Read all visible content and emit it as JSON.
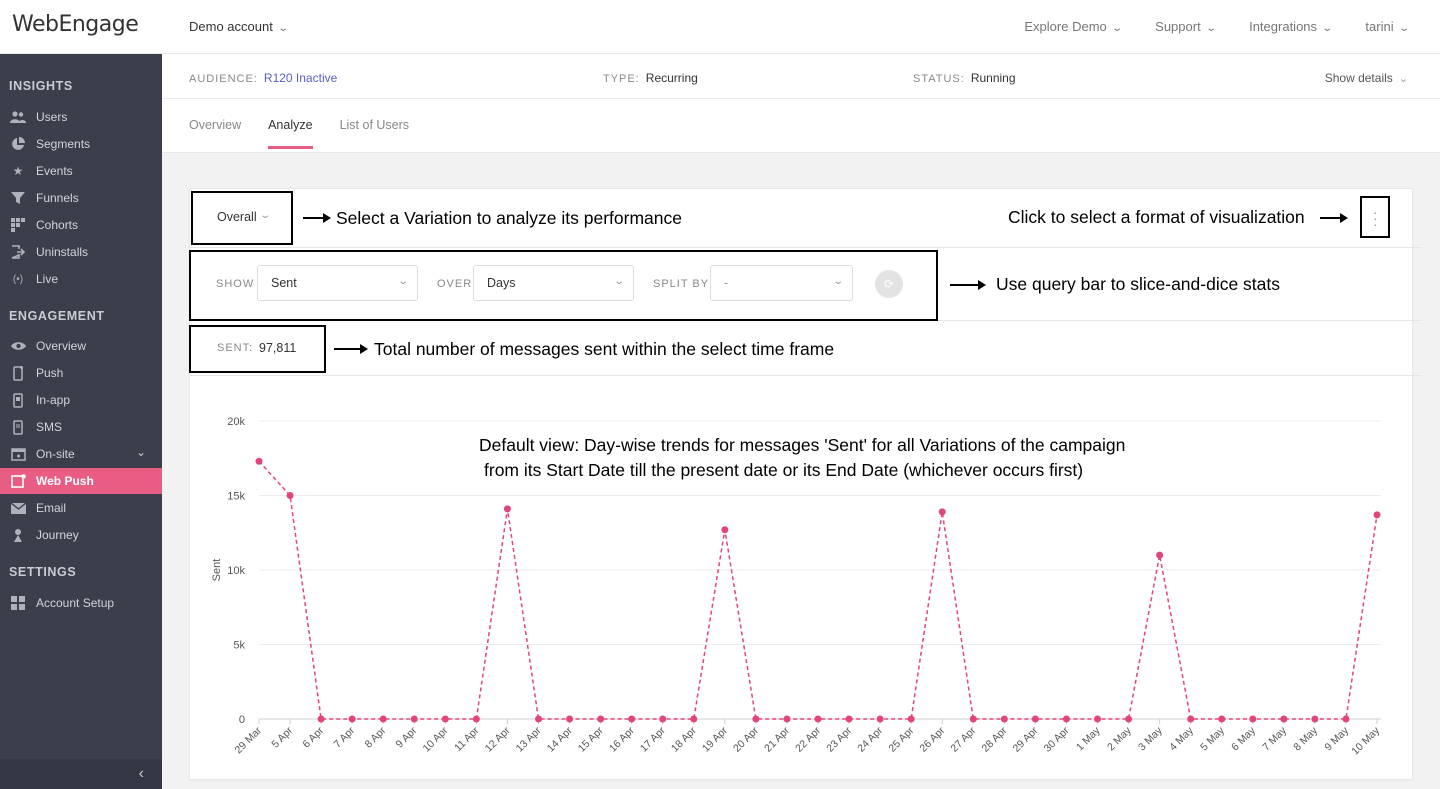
{
  "app": {
    "logo_text": "WebEngage",
    "account": "Demo account",
    "topnav": [
      "Explore Demo",
      "Support",
      "Integrations",
      "tarini"
    ]
  },
  "sidebar": {
    "sections": [
      {
        "title": "INSIGHTS",
        "items": [
          {
            "label": "Users",
            "icon": "users-icon"
          },
          {
            "label": "Segments",
            "icon": "pie-icon"
          },
          {
            "label": "Events",
            "icon": "star-icon"
          },
          {
            "label": "Funnels",
            "icon": "funnel-icon"
          },
          {
            "label": "Cohorts",
            "icon": "grid-icon"
          },
          {
            "label": "Uninstalls",
            "icon": "exit-icon"
          },
          {
            "label": "Live",
            "icon": "broadcast-icon"
          }
        ]
      },
      {
        "title": "ENGAGEMENT",
        "items": [
          {
            "label": "Overview",
            "icon": "eye-icon"
          },
          {
            "label": "Push",
            "icon": "mobile-icon"
          },
          {
            "label": "In-app",
            "icon": "tablet-icon"
          },
          {
            "label": "SMS",
            "icon": "sms-icon"
          },
          {
            "label": "On-site",
            "icon": "window-icon"
          },
          {
            "label": "Web Push",
            "icon": "browser-icon",
            "active": true
          },
          {
            "label": "Email",
            "icon": "mail-icon"
          },
          {
            "label": "Journey",
            "icon": "journey-icon"
          }
        ]
      },
      {
        "title": "SETTINGS",
        "items": [
          {
            "label": "Account Setup",
            "icon": "setup-icon"
          }
        ]
      }
    ]
  },
  "campaign": {
    "audience_label": "AUDIENCE:",
    "audience_value": "R120 Inactive",
    "type_label": "TYPE:",
    "type_value": "Recurring",
    "status_label": "STATUS:",
    "status_value": "Running",
    "show_details": "Show details",
    "tabs": [
      "Overview",
      "Analyze",
      "List of Users"
    ],
    "active_tab": "Analyze"
  },
  "analyze": {
    "variation_select": "Overall",
    "query": {
      "show_label": "SHOW",
      "show_value": "Sent",
      "over_label": "OVER",
      "over_value": "Days",
      "split_label": "SPLIT BY",
      "split_value": "-"
    },
    "sent_label": "SENT:",
    "sent_value": "97,811"
  },
  "annotations": {
    "variation": "Select a Variation to analyze its performance",
    "visualization": "Click to select a format of visualization",
    "query_bar": "Use query bar to slice-and-dice stats",
    "total": "Total number of messages sent within the select time frame",
    "default_view_1": "Default view: Day-wise trends for messages 'Sent' for all Variations of the campaign",
    "default_view_2": "from its Start Date till the present date or its End Date (whichever occurs first)"
  },
  "chart_data": {
    "type": "line",
    "ylabel": "Sent",
    "ylim": [
      0,
      20000
    ],
    "yticks": [
      "0",
      "5k",
      "10k",
      "15k",
      "20k"
    ],
    "ytick_values": [
      0,
      5000,
      10000,
      15000,
      20000
    ],
    "color": "#e0457b",
    "line_style": "dashed",
    "x": [
      "29 Mar",
      "5 Apr",
      "6 Apr",
      "7 Apr",
      "8 Apr",
      "9 Apr",
      "10 Apr",
      "11 Apr",
      "12 Apr",
      "13 Apr",
      "14 Apr",
      "15 Apr",
      "16 Apr",
      "17 Apr",
      "18 Apr",
      "19 Apr",
      "20 Apr",
      "21 Apr",
      "22 Apr",
      "23 Apr",
      "24 Apr",
      "25 Apr",
      "26 Apr",
      "27 Apr",
      "28 Apr",
      "29 Apr",
      "30 Apr",
      "1 May",
      "2 May",
      "3 May",
      "4 May",
      "5 May",
      "6 May",
      "7 May",
      "8 May",
      "9 May",
      "10 May"
    ],
    "values": [
      17300,
      15000,
      0,
      0,
      0,
      0,
      0,
      0,
      14100,
      0,
      0,
      0,
      0,
      0,
      0,
      12700,
      0,
      0,
      0,
      0,
      0,
      0,
      13900,
      0,
      0,
      0,
      0,
      0,
      0,
      11000,
      0,
      0,
      0,
      0,
      0,
      0,
      13700
    ]
  }
}
